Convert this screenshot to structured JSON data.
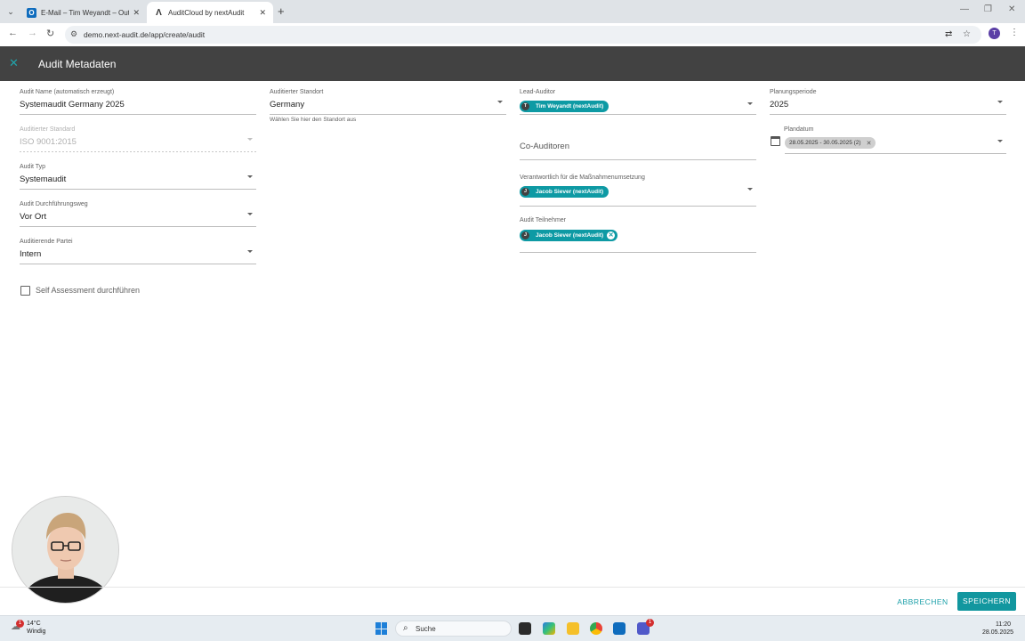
{
  "browser": {
    "tabs": [
      {
        "title": "E-Mail – Tim Weyandt – Outlook",
        "icon": "outlook-icon",
        "active": false
      },
      {
        "title": "AuditCloud by nextAudit",
        "icon": "nextaudit-icon",
        "active": true
      }
    ],
    "url": "demo.next-audit.de/app/create/audit",
    "profile_initial": "T"
  },
  "header": {
    "title": "Audit Metadaten",
    "accent": "#21a3aa",
    "background": "#424242"
  },
  "form": {
    "audit_name": {
      "label": "Audit Name (automatisch erzeugt)",
      "value": "Systemaudit Germany 2025"
    },
    "standard": {
      "label": "Auditierter Standard",
      "value": "ISO 9001:2015"
    },
    "audit_typ": {
      "label": "Audit Typ",
      "value": "Systemaudit"
    },
    "durchfuehrungsweg": {
      "label": "Audit Durchführungsweg",
      "value": "Vor Ort"
    },
    "partei": {
      "label": "Auditierende Partei",
      "value": "Intern"
    },
    "standort": {
      "label": "Auditierter Standort",
      "value": "Germany",
      "hint": "Wählen Sie hier den Standort aus"
    },
    "lead_auditor": {
      "label": "Lead-Auditor",
      "chip": {
        "initial": "T",
        "name": "Tim Weyandt (nextAudit)"
      }
    },
    "co_auditoren": {
      "placeholder": "Co-Auditoren"
    },
    "verantwortlich": {
      "label": "Verantwortlich für die Maßnahmenumsetzung",
      "chip": {
        "initial": "J",
        "name": "Jacob Siever (nextAudit)"
      }
    },
    "teilnehmer": {
      "label": "Audit Teilnehmer",
      "chip": {
        "initial": "J",
        "name": "Jacob Siever (nextAudit)"
      }
    },
    "planungsperiode": {
      "label": "Planungsperiode",
      "value": "2025"
    },
    "plandatum": {
      "label": "Plandatum",
      "chip": "28.05.2025 - 30.05.2025 (2)"
    },
    "self_assessment": {
      "label": "Self Assessment durchführen",
      "checked": false
    }
  },
  "actions": {
    "cancel": "ABBRECHEN",
    "save": "SPEICHERN",
    "primary_color": "#12979f"
  },
  "taskbar": {
    "weather_temp": "14°C",
    "weather_cond": "Windig",
    "weather_badge": "1",
    "search_placeholder": "Suche",
    "teams_badge": "1",
    "time": "11:20",
    "date": "28.05.2025"
  }
}
